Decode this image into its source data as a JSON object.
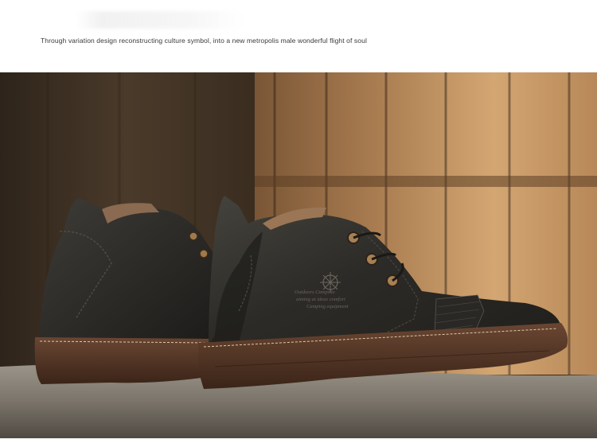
{
  "header": {
    "tagline": "Through variation design reconstructing culture symbol, into a new  metropolis male wonderful flight of soul"
  },
  "product_image": {
    "emblem_text_line1": "Outdoors                 Campsite",
    "emblem_text_line2": "aiming at ideas comfort",
    "emblem_text_line3": "Camping equipment",
    "colors": {
      "leather": "#2b2a26",
      "sole": "#4a2e20",
      "wood_light": "#c99a63",
      "wood_dark": "#3b2a1c",
      "stone": "#8a857c"
    }
  }
}
